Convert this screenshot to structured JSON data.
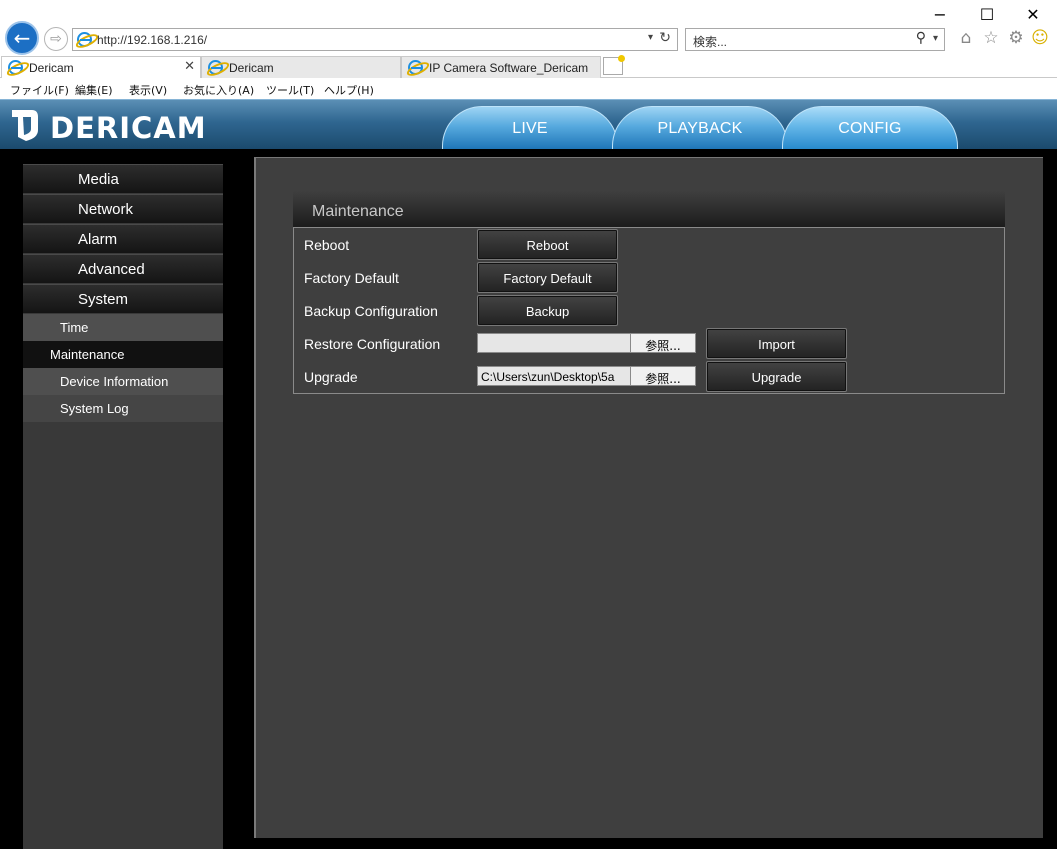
{
  "browser": {
    "address": "http://192.168.1.216/",
    "search_placeholder": "検索...",
    "window_controls": {
      "minimize": "−",
      "maximize": "☐",
      "close": "✕"
    },
    "nav": {
      "back": "←",
      "forward": "⇨"
    },
    "tabs": [
      {
        "label": "Dericam",
        "active": true,
        "close": "✕"
      },
      {
        "label": "Dericam",
        "active": false
      },
      {
        "label": "IP Camera Software_Dericam",
        "active": false
      }
    ],
    "menu": [
      "ファイル(F)",
      "編集(E)",
      "表示(V)",
      "お気に入り(A)",
      "ツール(T)",
      "ヘルプ(H)"
    ],
    "toolbar_icons": [
      "home-icon",
      "favorites-star-icon",
      "settings-gear-icon",
      "smiley-feedback-icon"
    ],
    "colors": {
      "back_button": "#1c6fc4",
      "accent_star": "#f0c800"
    }
  },
  "app": {
    "brand": "DERICAM",
    "nav_tabs": [
      {
        "label": "LIVE",
        "active": false
      },
      {
        "label": "PLAYBACK",
        "active": false
      },
      {
        "label": "CONFIG",
        "active": true
      }
    ],
    "sidebar": {
      "menu": [
        "Media",
        "Network",
        "Alarm",
        "Advanced",
        "System"
      ],
      "system_sub": [
        {
          "label": "Time",
          "selected": false
        },
        {
          "label": "Maintenance",
          "selected": true
        },
        {
          "label": "Device Information",
          "selected": false
        },
        {
          "label": "System Log",
          "selected": false
        }
      ]
    },
    "maintenance": {
      "title": "Maintenance",
      "rows": {
        "reboot": {
          "label": "Reboot",
          "button": "Reboot"
        },
        "factory_default": {
          "label": "Factory Default",
          "button": "Factory Default"
        },
        "backup": {
          "label": "Backup Configuration",
          "button": "Backup"
        },
        "restore": {
          "label": "Restore Configuration",
          "file_value": "",
          "browse": "参照...",
          "button": "Import"
        },
        "upgrade": {
          "label": "Upgrade",
          "file_value": "C:\\Users\\zun\\Desktop\\5a",
          "browse": "参照...",
          "button": "Upgrade"
        }
      }
    },
    "colors": {
      "header": "#2f6690",
      "tab_blue": "#56a9de",
      "panel": "#3f3f3f",
      "sidebar": "#393939"
    }
  }
}
